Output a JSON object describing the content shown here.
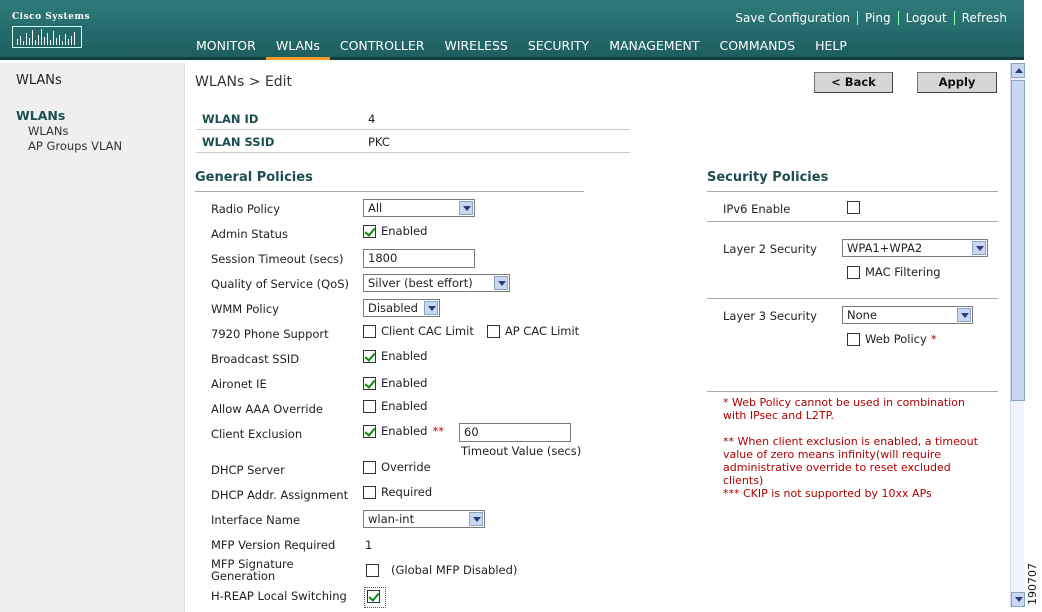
{
  "brand": "Cisco Systems",
  "top_links": [
    "Save Configuration",
    "Ping",
    "Logout",
    "Refresh"
  ],
  "nav": [
    "MONITOR",
    "WLANs",
    "CONTROLLER",
    "WIRELESS",
    "SECURITY",
    "MANAGEMENT",
    "COMMANDS",
    "HELP"
  ],
  "nav_active": "WLANs",
  "sidebar": {
    "title": "WLANs",
    "section": "WLANs",
    "links": [
      "WLANs",
      "AP Groups VLAN"
    ]
  },
  "page": {
    "title": "WLANs > Edit",
    "back": "< Back",
    "apply": "Apply"
  },
  "wlan": {
    "id_label": "WLAN ID",
    "id_value": "4",
    "ssid_label": "WLAN SSID",
    "ssid_value": "PKC"
  },
  "general": {
    "title": "General Policies",
    "radio_policy": {
      "label": "Radio Policy",
      "value": "All"
    },
    "admin_status": {
      "label": "Admin Status",
      "option": "Enabled",
      "checked": true
    },
    "session_timeout": {
      "label": "Session Timeout (secs)",
      "value": "1800"
    },
    "qos": {
      "label": "Quality of Service (QoS)",
      "value": "Silver (best effort)"
    },
    "wmm": {
      "label": "WMM Policy",
      "value": "Disabled"
    },
    "phone_7920": {
      "label": "7920 Phone Support",
      "opt1": "Client CAC Limit",
      "opt2": "AP CAC Limit"
    },
    "broadcast_ssid": {
      "label": "Broadcast SSID",
      "option": "Enabled",
      "checked": true
    },
    "aironet_ie": {
      "label": "Aironet IE",
      "option": "Enabled",
      "checked": true
    },
    "aaa_override": {
      "label": "Allow AAA Override",
      "option": "Enabled",
      "checked": false
    },
    "client_exclusion": {
      "label": "Client Exclusion",
      "option": "Enabled",
      "marker": "**",
      "timeout": "60",
      "timeout_label": "Timeout Value (secs)",
      "checked": true
    },
    "dhcp_server": {
      "label": "DHCP Server",
      "option": "Override",
      "checked": false
    },
    "dhcp_addr": {
      "label": "DHCP Addr. Assignment",
      "option": "Required",
      "checked": false
    },
    "interface": {
      "label": "Interface Name",
      "value": "wlan-int"
    },
    "mfp_version": {
      "label": "MFP Version Required",
      "value": "1"
    },
    "mfp_sig": {
      "label_1": "MFP Signature",
      "label_2": "Generation",
      "note": "(Global MFP Disabled)",
      "checked": false
    },
    "hreap": {
      "label": "H-REAP Local Switching",
      "checked": true
    }
  },
  "security": {
    "title": "Security Policies",
    "ipv6": {
      "label": "IPv6 Enable",
      "checked": false
    },
    "layer2": {
      "label": "Layer 2 Security",
      "value": "WPA1+WPA2",
      "mac_filtering": "MAC Filtering"
    },
    "layer3": {
      "label": "Layer 3 Security",
      "value": "None",
      "web_policy": "Web Policy",
      "marker": "*"
    },
    "notes": [
      "* Web Policy cannot be used in combination",
      "with IPsec and L2TP.",
      "** When client exclusion is enabled, a timeout",
      "value of zero means infinity(will require",
      "administrative override to reset excluded",
      "clients)",
      "*** CKIP is not supported by 10xx APs"
    ]
  },
  "figure_id": "190707",
  "colors": {
    "header": "#1e5e5f",
    "accent": "#f59a26",
    "heading": "#1d4f4f",
    "note": "#b00000"
  }
}
